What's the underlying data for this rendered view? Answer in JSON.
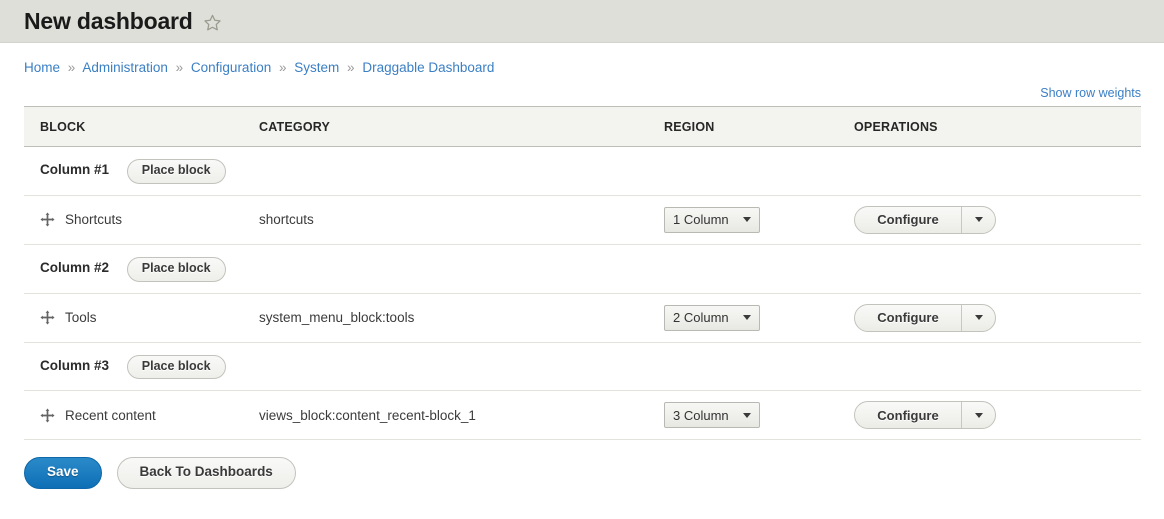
{
  "header": {
    "title": "New dashboard",
    "star_icon": "star-outline-icon"
  },
  "breadcrumb": {
    "separator": "»",
    "items": [
      {
        "label": "Home"
      },
      {
        "label": "Administration"
      },
      {
        "label": "Configuration"
      },
      {
        "label": "System"
      },
      {
        "label": "Draggable Dashboard"
      }
    ]
  },
  "row_weights": {
    "label": "Show row weights"
  },
  "table": {
    "columns": [
      {
        "label": "BLOCK"
      },
      {
        "label": "CATEGORY"
      },
      {
        "label": "REGION"
      },
      {
        "label": "OPERATIONS"
      }
    ],
    "place_block_label": "Place block",
    "configure_label": "Configure",
    "drag_icon": "move-cross-icon",
    "dropdown_icon": "chevron-down-icon",
    "groups": [
      {
        "region_label": "Column #1",
        "rows": [
          {
            "block": "Shortcuts",
            "category": "shortcuts",
            "region": "1 Column",
            "operation": "Configure"
          }
        ]
      },
      {
        "region_label": "Column #2",
        "rows": [
          {
            "block": "Tools",
            "category": "system_menu_block:tools",
            "region": "2 Column",
            "operation": "Configure"
          }
        ]
      },
      {
        "region_label": "Column #3",
        "rows": [
          {
            "block": "Recent content",
            "category": "views_block:content_recent-block_1",
            "region": "3 Column",
            "operation": "Configure"
          }
        ]
      }
    ]
  },
  "actions": {
    "save_label": "Save",
    "back_label": "Back To Dashboards"
  },
  "colors": {
    "header_band": "#dfdfd9",
    "link": "#3b7fc4",
    "table_header_bg": "#f3f3ef",
    "primary_button": "#0e6fb6"
  }
}
